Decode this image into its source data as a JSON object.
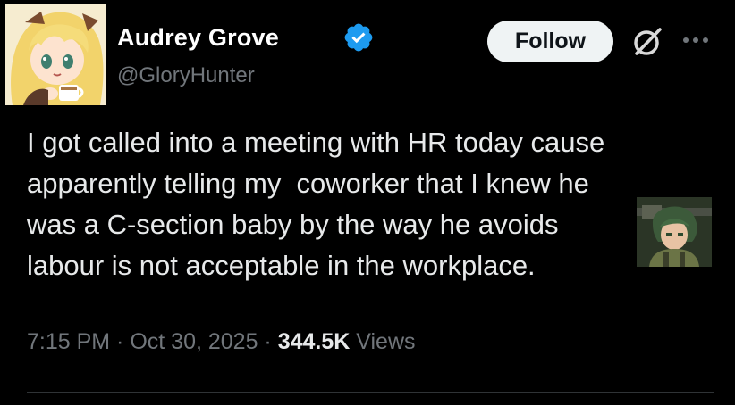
{
  "author": {
    "display_name": "Audrey Grove",
    "handle": "@GloryHunter",
    "verified": true,
    "verified_icon": "verified-badge-icon",
    "avatar_icon": "anime-girl-avatar"
  },
  "actions": {
    "follow_label": "Follow",
    "grok_icon": "grok-icon",
    "more_icon": "more-icon"
  },
  "tweet": {
    "lines": [
      "I got called into a meeting with HR today cause",
      "apparently telling my  coworker that I knew he",
      "was a C-section baby by the way he avoids",
      "labour is not acceptable in the workplace."
    ],
    "sticker_icon": "anime-boy-sticker"
  },
  "meta": {
    "time": "7:15 PM",
    "separator": " · ",
    "date": "Oct 30, 2025",
    "views_count": "344.5K",
    "views_label": " Views"
  },
  "colors": {
    "background": "#000000",
    "text_primary": "#e7e9ea",
    "text_secondary": "#71767b",
    "verified_blue": "#1d9bf0",
    "follow_bg": "#eff3f4",
    "divider": "#2f3336"
  }
}
